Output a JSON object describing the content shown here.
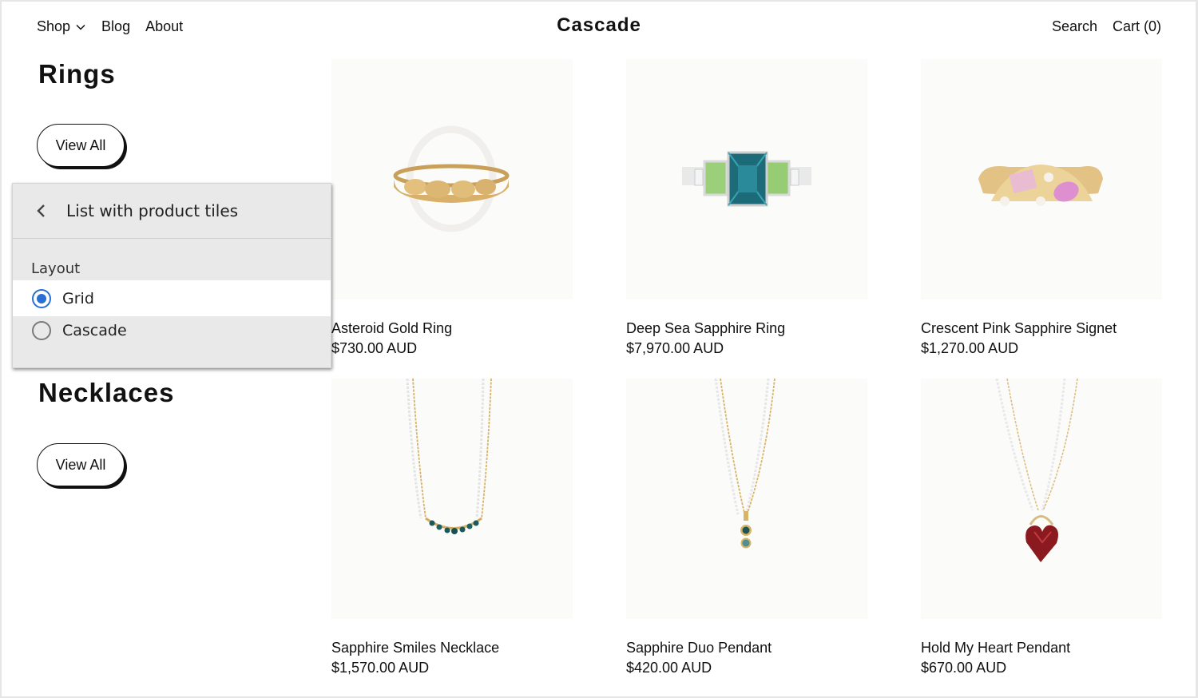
{
  "header": {
    "brand": "Cascade",
    "nav_left": [
      {
        "label": "Shop",
        "has_dropdown": true
      },
      {
        "label": "Blog"
      },
      {
        "label": "About"
      }
    ],
    "nav_right": [
      {
        "label": "Search"
      },
      {
        "label": "Cart (0)"
      }
    ]
  },
  "sections": [
    {
      "title": "Rings",
      "view_all_label": "View All",
      "products": [
        {
          "name": "Asteroid Gold Ring",
          "price": "$730.00 AUD",
          "image": "gold-band-ring"
        },
        {
          "name": "Deep Sea Sapphire Ring",
          "price": "$7,970.00 AUD",
          "image": "teal-sapphire-ring"
        },
        {
          "name": "Crescent Pink Sapphire Signet",
          "price": "$1,270.00 AUD",
          "image": "pink-sapphire-signet-ring"
        }
      ]
    },
    {
      "title": "Necklaces",
      "view_all_label": "View All",
      "products": [
        {
          "name": "Sapphire Smiles Necklace",
          "price": "$1,570.00 AUD",
          "image": "sapphire-bar-necklace"
        },
        {
          "name": "Sapphire Duo Pendant",
          "price": "$420.00 AUD",
          "image": "sapphire-duo-pendant"
        },
        {
          "name": "Hold My Heart Pendant",
          "price": "$670.00 AUD",
          "image": "garnet-heart-pendant"
        }
      ]
    }
  ],
  "popup": {
    "title": "List with product tiles",
    "back_icon": "chevron-left-icon",
    "field_label": "Layout",
    "options": [
      {
        "label": "Grid",
        "selected": true
      },
      {
        "label": "Cascade",
        "selected": false
      }
    ],
    "accent_color": "#2a6fd4"
  },
  "colors": {
    "gold": "#d9b36a",
    "teal_gem": "#1d6b78",
    "green_gem": "#8fc46a",
    "pink_gem": "#e6a6d6",
    "garnet": "#8a1a1f"
  }
}
